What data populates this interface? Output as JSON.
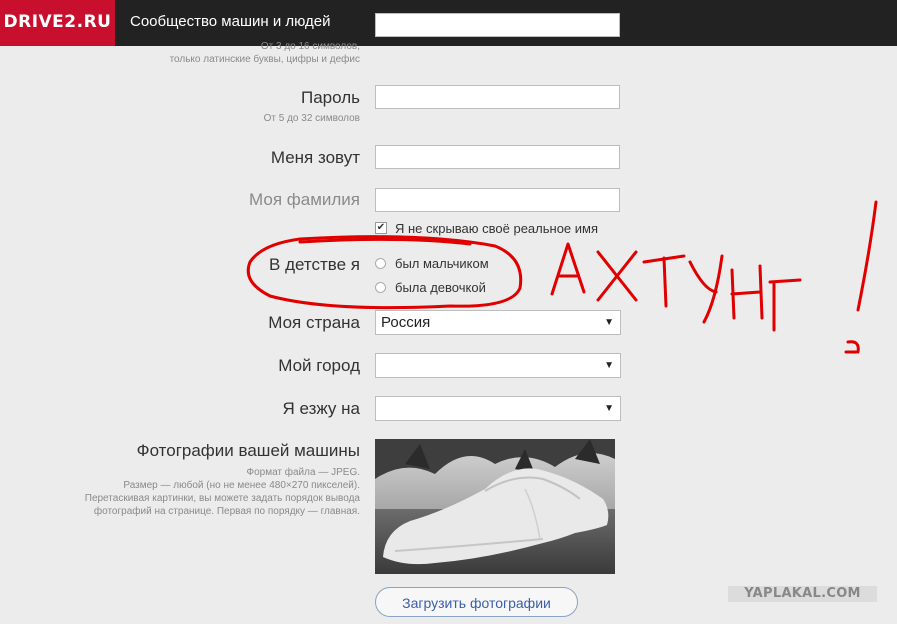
{
  "header": {
    "logo": "DRIVE2.RU",
    "tagline": "Сообщество машин и людей"
  },
  "form": {
    "nickname_hint_1": "От 3 до 16 символов,",
    "nickname_hint_2": "только латинские буквы, цифры и дефис",
    "password_label": "Пароль",
    "password_hint": "От 5 до 32 символов",
    "name_label": "Меня зовут",
    "surname_label": "Моя фамилия",
    "real_name_checkbox": "Я не скрываю своё реальное имя",
    "real_name_checked": true,
    "gender_label": "В детстве я",
    "gender_options": [
      "был мальчиком",
      "была девочкой"
    ],
    "country_label": "Моя страна",
    "country_value": "Россия",
    "city_label": "Мой город",
    "city_value": "",
    "car_label": "Я езжу на",
    "car_value": "",
    "photos_label": "Фотографии вашей машины",
    "photos_hint_1": "Формат файла — JPEG.",
    "photos_hint_2": "Размер — любой (но не менее 480×270 пикселей).",
    "photos_hint_3": "Перетаскивая картинки, вы можете задать порядок вывода",
    "photos_hint_4": "фотографий на странице. Первая по порядку — главная.",
    "upload_button": "Загрузить фотографии"
  },
  "annotation": {
    "scrawl": "АХТУНГ!",
    "accent": "#e00000"
  },
  "watermark": "YAPLAKAL.COM",
  "icons": {
    "dropdown": "triangle-down-icon",
    "check": "checkmark-icon"
  }
}
